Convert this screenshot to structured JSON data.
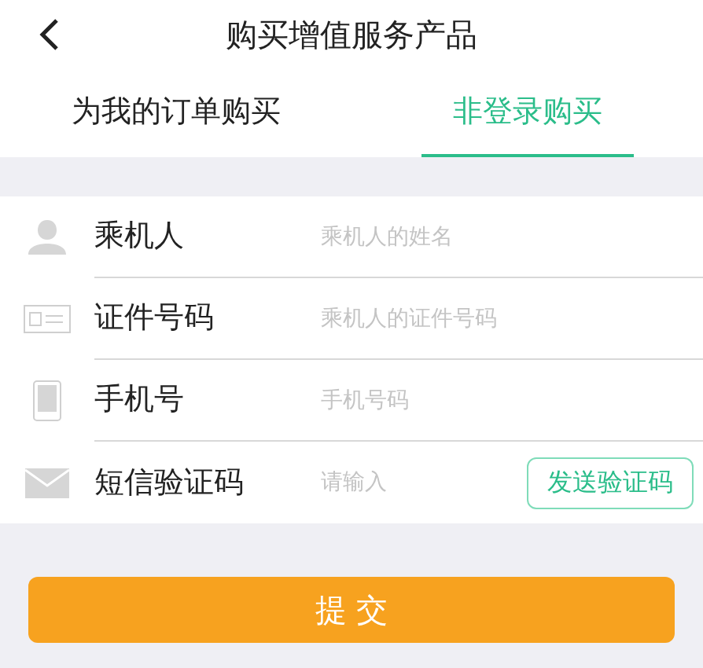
{
  "header": {
    "title": "购买增值服务产品"
  },
  "tabs": [
    {
      "label": "为我的订单购买",
      "selected": false
    },
    {
      "label": "非登录购买",
      "selected": true
    }
  ],
  "form": [
    {
      "label": "乘机人",
      "placeholder": "乘机人的姓名"
    },
    {
      "label": "证件号码",
      "placeholder": "乘机人的证件号码"
    },
    {
      "label": "手机号",
      "placeholder": "手机号码"
    },
    {
      "label": "短信验证码",
      "placeholder": "请输入",
      "action": "发送验证码"
    }
  ],
  "submit": "提 交"
}
